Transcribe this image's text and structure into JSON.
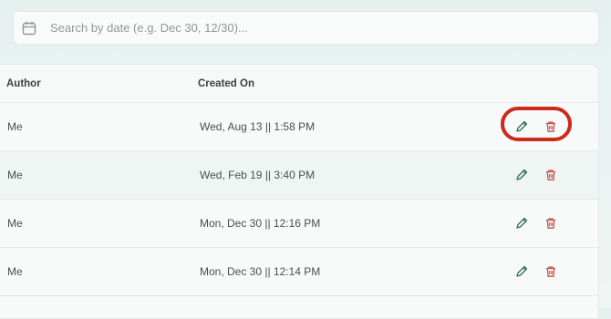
{
  "search": {
    "placeholder": "Search by date (e.g. Dec 30, 12/30)...",
    "value": "",
    "icon": "calendar-icon"
  },
  "table": {
    "columns": [
      "Author",
      "Created On"
    ],
    "rows": [
      {
        "author": "Me",
        "created_on": "Wed, Aug 13 || 1:58 PM"
      },
      {
        "author": "Me",
        "created_on": "Wed, Feb 19 || 3:40 PM"
      },
      {
        "author": "Me",
        "created_on": "Mon, Dec 30 || 12:16 PM"
      },
      {
        "author": "Me",
        "created_on": "Mon, Dec 30 || 12:14 PM"
      }
    ],
    "row_actions": [
      "pencil-icon",
      "trash-icon"
    ]
  },
  "colors": {
    "edit": "#2e6b5e",
    "delete": "#c0504d",
    "highlight": "#cc2a1b"
  }
}
